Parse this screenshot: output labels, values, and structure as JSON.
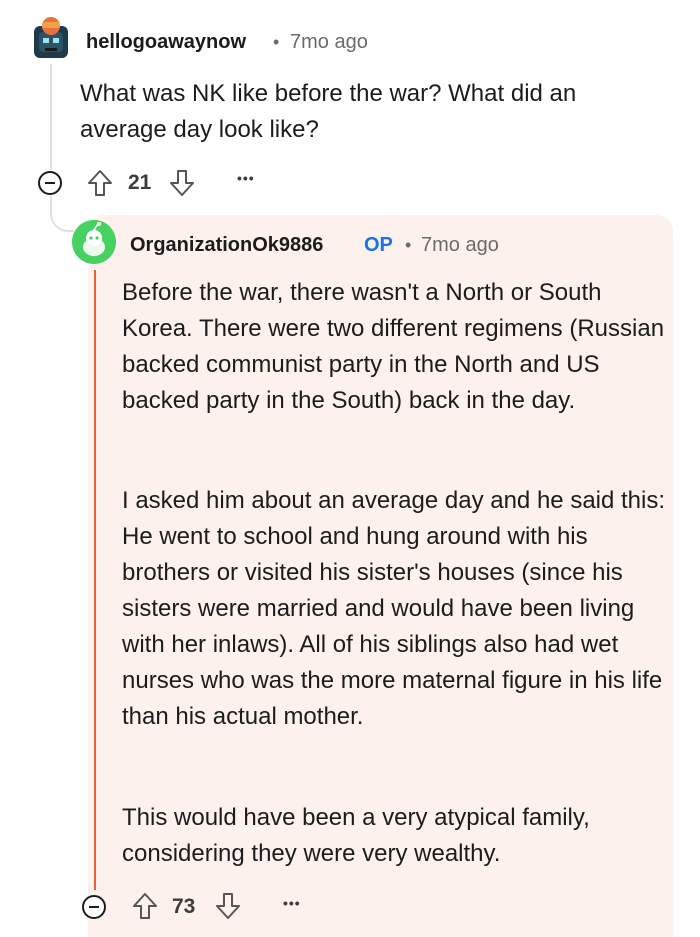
{
  "parent_comment": {
    "username": "hellogoawaynow",
    "time": "7mo ago",
    "body": "What was NK like before the war? What did an average day look like?",
    "votes": "21"
  },
  "reply_comment": {
    "username": "OrganizationOk9886",
    "op_badge": "OP",
    "time": "7mo ago",
    "paragraphs": [
      "Before the war, there wasn't a North or South Korea. There were two different regimens (Russian backed communist party in the North and US backed party in the South) back in the day.",
      "I asked him about an average day and he said this: He went to school and hung around with his brothers or visited his sister's houses (since his sisters were married and would have been living with her inlaws). All of his siblings also had wet nurses who was the more maternal figure in his life than his actual mother.",
      "This would have been a very atypical family, considering they were very wealthy."
    ],
    "votes": "73"
  },
  "separator": "•",
  "more_label": "•••",
  "colors": {
    "reply_background": "#fcf1ed",
    "reply_thread_line": "#e8603a",
    "op_badge": "#1a73e8",
    "avatar_green": "#46d160"
  },
  "icons": [
    "upvote-icon",
    "downvote-icon",
    "collapse-icon",
    "more-options-icon",
    "user-avatar"
  ]
}
